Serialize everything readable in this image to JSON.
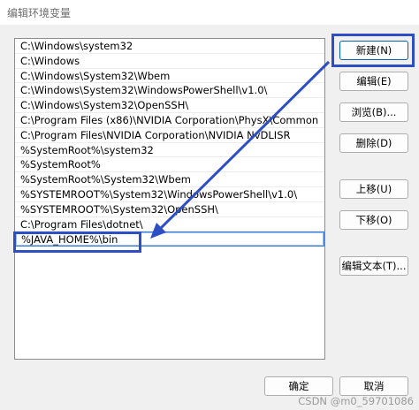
{
  "window": {
    "title": "编辑环境变量"
  },
  "paths": [
    "C:\\Windows\\system32",
    "C:\\Windows",
    "C:\\Windows\\System32\\Wbem",
    "C:\\Windows\\System32\\WindowsPowerShell\\v1.0\\",
    "C:\\Windows\\System32\\OpenSSH\\",
    "C:\\Program Files (x86)\\NVIDIA Corporation\\PhysX\\Common",
    "C:\\Program Files\\NVIDIA Corporation\\NVIDIA NvDLISR",
    "%SystemRoot%\\system32",
    "%SystemRoot%",
    "%SystemRoot%\\System32\\Wbem",
    "%SYSTEMROOT%\\System32\\WindowsPowerShell\\v1.0\\",
    "%SYSTEMROOT%\\System32\\OpenSSH\\",
    "C:\\Program Files\\dotnet\\",
    "%JAVA_HOME%\\bin"
  ],
  "buttons": {
    "new": "新建(N)",
    "edit": "编辑(E)",
    "browse": "浏览(B)...",
    "delete": "删除(D)",
    "move_up": "上移(U)",
    "move_down": "下移(O)",
    "edit_text": "编辑文本(T)...",
    "ok": "确定",
    "cancel": "取消"
  },
  "watermark": "CSDN @m0_59701086",
  "colors": {
    "annotation": "#2e4fc4",
    "selection": "#3a7bd5"
  }
}
